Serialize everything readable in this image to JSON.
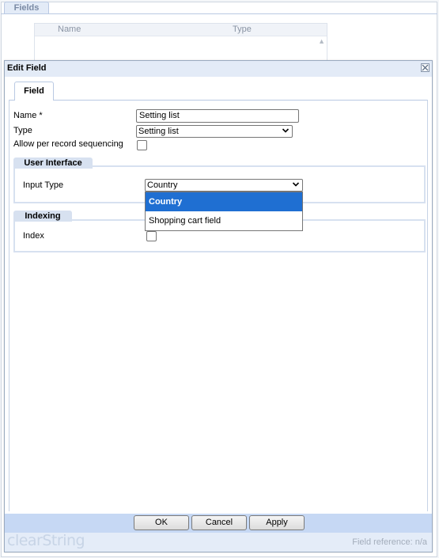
{
  "background": {
    "tab_label": "Fields",
    "grid_columns": [
      "Name",
      "Type"
    ]
  },
  "dialog": {
    "title": "Edit Field",
    "tab_label": "Field",
    "name": {
      "label": "Name *",
      "value": "Setting list"
    },
    "type": {
      "label": "Type",
      "value": "Setting list"
    },
    "sequencing": {
      "label": "Allow per record sequencing",
      "checked": false
    },
    "user_interface": {
      "legend": "User Interface",
      "input_type_label": "Input Type",
      "input_type_value": "Country",
      "options": [
        "Country",
        "Shopping cart field"
      ]
    },
    "indexing": {
      "legend": "Indexing",
      "index_label": "Index",
      "checked": false
    },
    "buttons": {
      "ok": "OK",
      "cancel": "Cancel",
      "apply": "Apply"
    },
    "footer": {
      "logo": "clearString",
      "field_reference": "Field reference: n/a"
    }
  },
  "colors": {
    "selected_option": "#1f6fd2",
    "button_bar": "#c6d8f4",
    "title_bar": "#e3ebf7"
  }
}
